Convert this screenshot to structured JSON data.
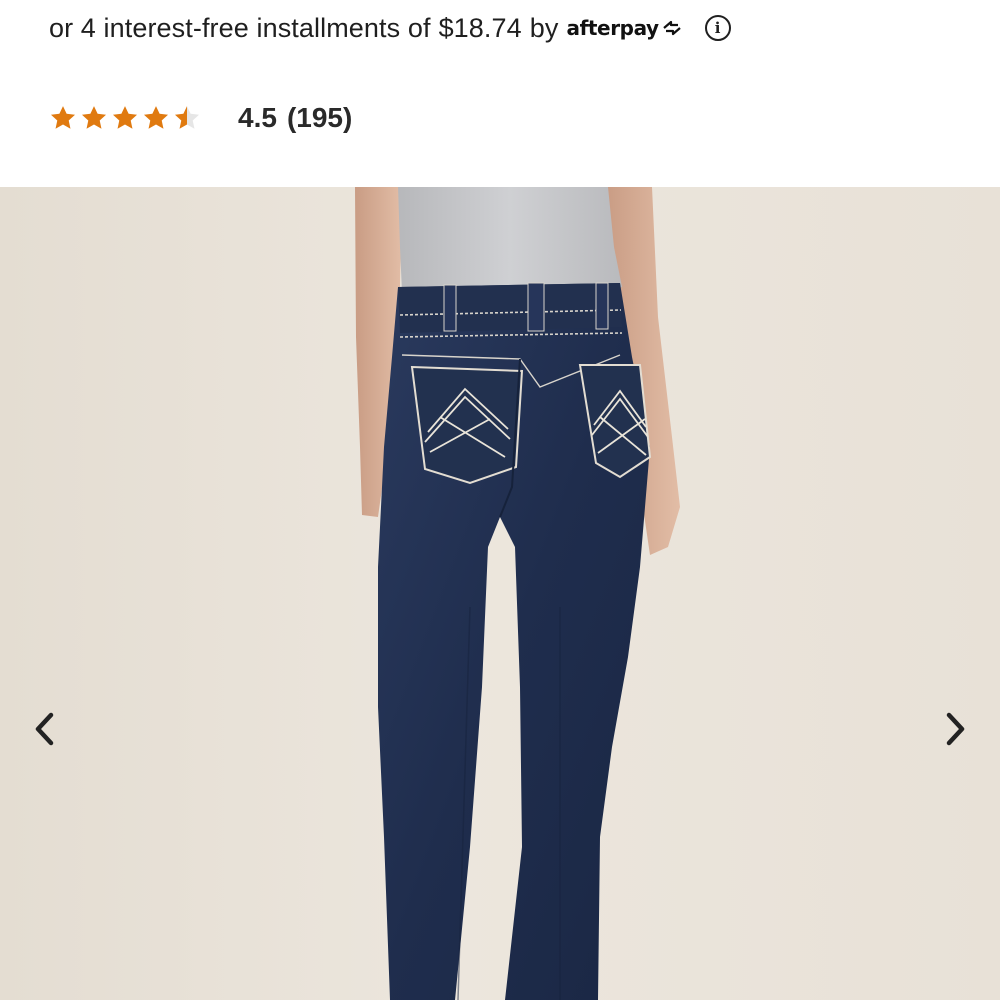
{
  "payment": {
    "prefix": "or 4 interest-free installments of",
    "amount": "$18.74",
    "by": "by",
    "provider": "afterpay",
    "info_icon": "info-icon"
  },
  "rating": {
    "stars_value": 4.5,
    "stars_max": 5,
    "star_color": "#e07a10",
    "value": "4.5",
    "count": "(195)"
  },
  "carousel": {
    "image_alt": "Back view of woman wearing dark wash bootcut jeans with stitched back pockets and grey t-shirt",
    "prev_icon": "chevron-left-icon",
    "next_icon": "chevron-right-icon"
  }
}
